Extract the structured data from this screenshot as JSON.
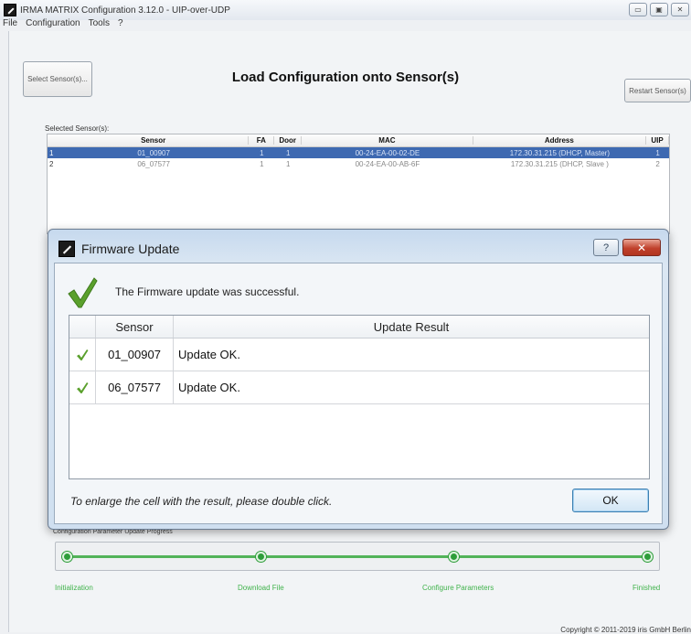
{
  "window": {
    "title": "IRMA MATRIX Configuration 3.12.0  -  UIP-over-UDP",
    "controls": {
      "minimize": "▭",
      "maximize": "▣",
      "close": "✕"
    }
  },
  "menu": [
    "File",
    "Configuration",
    "Tools",
    "?"
  ],
  "toolbar": {
    "select_sensors": "Select Sensor(s)...",
    "restart_sensors": "Restart Sensor(s)"
  },
  "page_title": "Load Configuration onto Sensor(s)",
  "selected_sensors": {
    "label": "Selected Sensor(s):",
    "columns": [
      "Sensor",
      "FA",
      "Door",
      "MAC",
      "Address",
      "UIP"
    ],
    "rows": [
      {
        "idx": "1",
        "sensor": "01_00907",
        "fa": "1",
        "door": "1",
        "mac": "00-24-EA-00-02-DE",
        "address": "172.30.31.215 (DHCP, Master)",
        "uip": "1"
      },
      {
        "idx": "2",
        "sensor": "06_07577",
        "fa": "1",
        "door": "1",
        "mac": "00-24-EA-00-AB-6F",
        "address": "172.30.31.215 (DHCP, Slave )",
        "uip": "2"
      }
    ]
  },
  "progress": {
    "label": "Configuration Parameter Update Progress",
    "steps": [
      "Initialization",
      "Download File",
      "Configure Parameters",
      "Finished"
    ]
  },
  "dialog": {
    "title": "Firmware Update",
    "help": "?",
    "close": "✕",
    "message": "The Firmware update was successful.",
    "columns": [
      "Sensor",
      "Update Result"
    ],
    "rows": [
      {
        "sensor": "01_00907",
        "result": "Update OK."
      },
      {
        "sensor": "06_07577",
        "result": "Update OK."
      }
    ],
    "hint": "To enlarge the cell with the result, please double click.",
    "ok": "OK"
  },
  "copyright": "Copyright © 2011-2019 iris GmbH Berlin",
  "colors": {
    "selection": "#3e69b1",
    "progress_green": "#2e9d3a",
    "check_green": "#5aa02c",
    "close_red": "#c0412c"
  },
  "icons": [
    "app-icon",
    "check-icon",
    "help-icon",
    "close-icon"
  ]
}
